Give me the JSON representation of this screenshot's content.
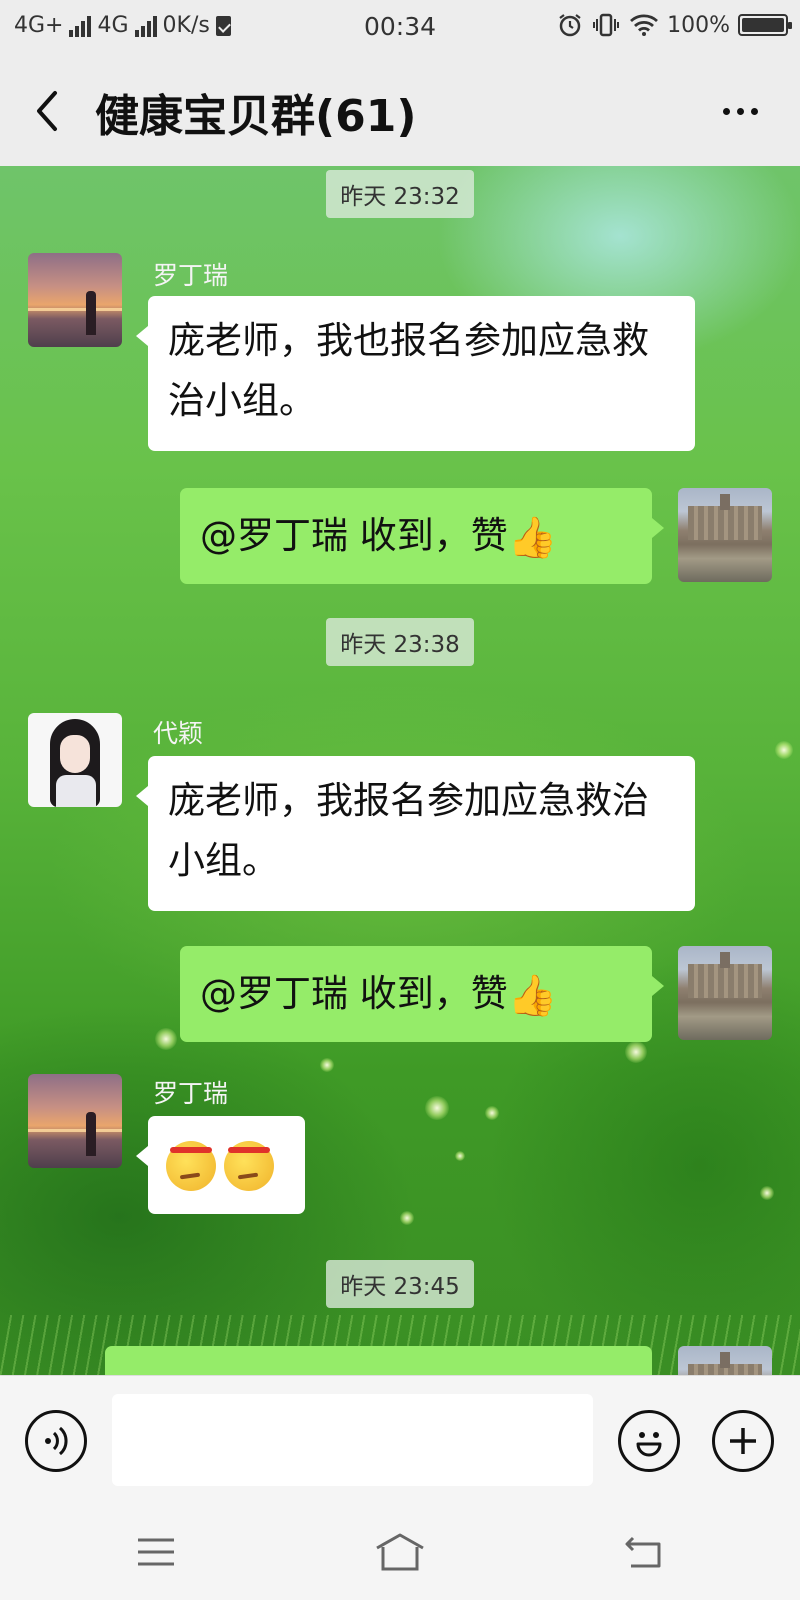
{
  "status_bar": {
    "network_1": "4G+",
    "network_2": "4G",
    "speed": "0K/s",
    "time": "00:34",
    "battery": "100%",
    "battery_level": 1.0
  },
  "header": {
    "title": "健康宝贝群(61)",
    "back_icon": "chevron-left-icon",
    "more_icon": "more-dots-icon"
  },
  "chat": {
    "timestamps": [
      "昨天 23:32",
      "昨天 23:38",
      "昨天 23:45"
    ],
    "messages": [
      {
        "side": "left",
        "sender": "罗丁瑞",
        "avatar": "sunset-avatar",
        "text": "庞老师，我也报名参加应急救治小组。"
      },
      {
        "side": "right",
        "avatar": "castle-avatar",
        "text": "@罗丁瑞  收到，赞",
        "emoji": "👍"
      },
      {
        "side": "left",
        "sender": "代颖",
        "avatar": "girl-avatar",
        "text": "庞老师，我报名参加应急救治小组。"
      },
      {
        "side": "right",
        "avatar": "castle-avatar",
        "text": "@罗丁瑞  收到，赞",
        "emoji": "👍"
      },
      {
        "side": "left",
        "sender": "罗丁瑞",
        "avatar": "sunset-avatar",
        "emojis": [
          "determined-face-emoji",
          "determined-face-emoji"
        ]
      }
    ]
  },
  "input_bar": {
    "voice_icon": "voice-icon",
    "input_value": "",
    "emoji_icon": "smile-icon",
    "plus_icon": "plus-icon"
  },
  "nav_bar": {
    "menu_icon": "menu-icon",
    "home_icon": "home-icon",
    "back_icon": "return-icon"
  }
}
